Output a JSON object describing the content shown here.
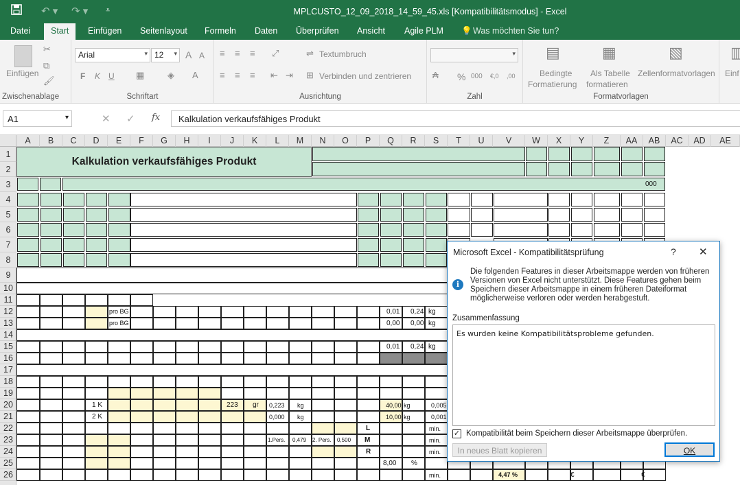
{
  "titlebar": {
    "title": "MPLCUSTO_12_09_2018_14_59_45.xls  [Kompatibilitätsmodus] - Excel",
    "save_icon": "save-icon",
    "undo_icon": "undo-icon",
    "redo_icon": "redo-icon",
    "customize_icon": "customize-quick-access-icon"
  },
  "tabs": [
    "Datei",
    "Start",
    "Einfügen",
    "Seitenlayout",
    "Formeln",
    "Daten",
    "Überprüfen",
    "Ansicht",
    "Agile PLM"
  ],
  "active_tab": "Start",
  "tell_me": "Was möchten Sie tun?",
  "ribbon": {
    "clipboard": {
      "paste_label": "Einfügen",
      "group": "Zwischenablage"
    },
    "font": {
      "font_name": "Arial",
      "font_size": "12",
      "bold": "F",
      "italic": "K",
      "underline": "U",
      "group": "Schriftart",
      "grow": "A",
      "shrink": "A"
    },
    "alignment": {
      "wrap": "Textumbruch",
      "merge": "Verbinden und zentrieren",
      "group": "Ausrichtung"
    },
    "number": {
      "group": "Zahl",
      "percent": "%",
      "thousands": "000",
      "inc_dec": "€,0",
      "dec_dec": ",00"
    },
    "styles": {
      "cond_format_1": "Bedingte",
      "cond_format_2": "Formatierung",
      "as_table_1": "Als Tabelle",
      "as_table_2": "formatieren",
      "cell_styles": "Zellenformatvorlagen",
      "group": "Formatvorlagen"
    },
    "cells": {
      "insert": "Einf"
    }
  },
  "formula_bar": {
    "name_box": "A1",
    "fx": "fx",
    "content": "Kalkulation verkaufsfähiges Produkt"
  },
  "columns": [
    "A",
    "B",
    "C",
    "D",
    "E",
    "F",
    "G",
    "H",
    "I",
    "J",
    "K",
    "L",
    "M",
    "N",
    "O",
    "P",
    "Q",
    "R",
    "S",
    "T",
    "U",
    "V",
    "W",
    "X",
    "Y",
    "Z",
    "AA",
    "AB",
    "AC",
    "AD",
    "AE"
  ],
  "rows": [
    "1",
    "2",
    "3",
    "4",
    "5",
    "6",
    "7",
    "8",
    "9",
    "10",
    "11",
    "12",
    "13",
    "14",
    "15",
    "16",
    "17",
    "18",
    "19",
    "20",
    "21",
    "22",
    "23",
    "24",
    "25",
    "26"
  ],
  "cells": {
    "heading": "Kalkulation verkaufsfähiges Produkt",
    "r3_ab": "000",
    "r12_e": "pro BG",
    "r13_e": "pro BG",
    "r12_q": "0,01",
    "r12_r": "0,24",
    "r12_s": "kg",
    "r13_q": "0,00",
    "r13_r": "0,00",
    "r13_s": "kg",
    "r15_q": "0,01",
    "r15_r": "0,24",
    "r15_s": "kg",
    "r20_d": "1 K",
    "r20_j": "223",
    "r20_k": "gr",
    "r20_l": "0,223",
    "r20_m": "kg",
    "r20_q": "40,00",
    "r20_r": "kg",
    "r20_s": "0,005",
    "r21_d": "2 K",
    "r21_l": "0,000",
    "r21_m": "kg",
    "r21_q": "10,00",
    "r21_r": "kg",
    "r21_s": "0,001",
    "r22_p": "L",
    "r22_s": "min.",
    "r23_l": "1.Pers.",
    "r23_m": "0,479",
    "r23_n": "2. Pers.",
    "r23_o": "0,500",
    "r23_p": "M",
    "r23_s": "min.",
    "r24_p": "R",
    "r24_s": "min.",
    "r25_q": "8,00",
    "r25_r": "%",
    "r26_s": "min.",
    "r26_v": "4,47 %",
    "r26_x": "€",
    "r26_aa": "€"
  },
  "dialog": {
    "title": "Microsoft Excel - Kompatibilitätsprüfung",
    "help": "?",
    "close": "✕",
    "message_1": "Die folgenden Features in dieser Arbeitsmappe werden von früheren",
    "message_2": "Versionen von Excel nicht unterstützt. Diese Features gehen beim",
    "message_3": "Speichern dieser Arbeitsmappe in einem früheren Dateiformat",
    "message_4": "möglicherweise verloren oder werden herabgestuft.",
    "summary_label": "Zusammenfassung",
    "summary_text": "Es wurden keine Kompatibilitätsprobleme gefunden.",
    "checkbox_label": "Kompatibilität beim Speichern dieser Arbeitsmappe überprüfen.",
    "checkbox_checked": true,
    "copy_button": "In neues Blatt kopieren",
    "ok_button": "OK"
  },
  "colors": {
    "excel_green": "#217346",
    "cell_green": "#c7e6d4",
    "cell_yellow": "#fdf7d2",
    "cell_gray": "#8c8c8c"
  }
}
